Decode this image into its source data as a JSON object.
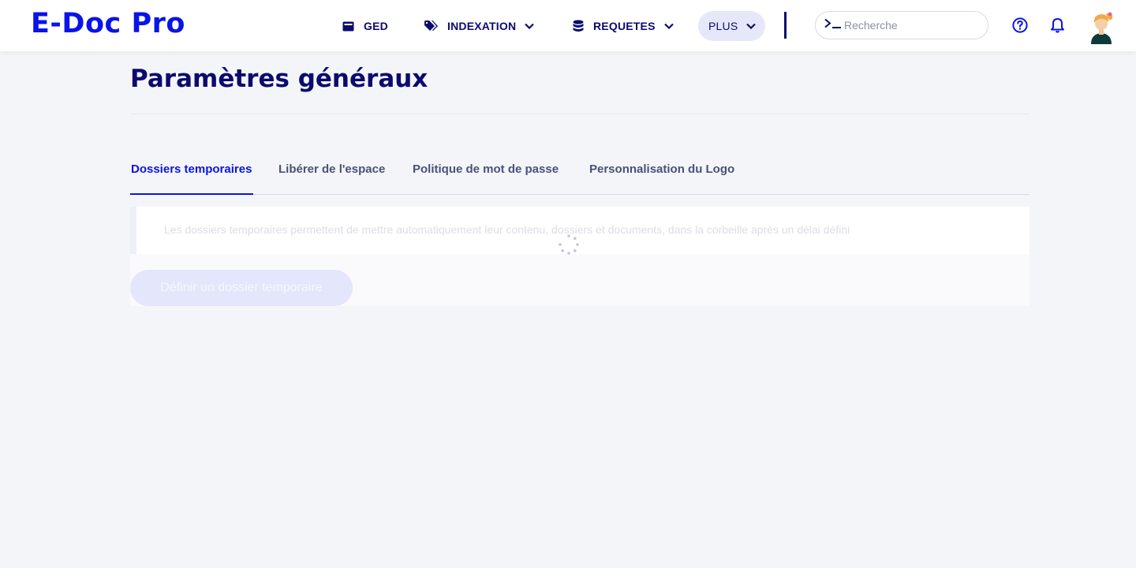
{
  "app": {
    "logo": "E-Doc Pro"
  },
  "nav": {
    "ged": "GED",
    "indexation": "INDEXATION",
    "requetes": "REQUETES",
    "plus": "PLUS"
  },
  "search": {
    "placeholder": "Recherche"
  },
  "icons": {
    "ged": "archive-box-icon",
    "indexation": "tags-icon",
    "requetes": "database-icon",
    "help": "help-circle-icon",
    "notifications": "bell-icon",
    "search_prompt": "terminal-prompt-icon"
  },
  "colors": {
    "brand": "#0a14e6",
    "navy": "#0b0b6e",
    "background": "#f4f5f8"
  },
  "page": {
    "title": "Paramètres généraux"
  },
  "tabs": [
    {
      "label": "Dossiers temporaires",
      "active": true
    },
    {
      "label": "Libérer de l'espace",
      "active": false
    },
    {
      "label": "Politique de mot de passe",
      "active": false
    },
    {
      "label": "Personnalisation du Logo",
      "active": false
    }
  ],
  "panel": {
    "info": "Les dossiers temporaires permettent de mettre automatiquement leur contenu, dossiers et documents, dans la corbeille après un délai défini",
    "button": "Définir un dossier temporaire",
    "loading": true
  }
}
